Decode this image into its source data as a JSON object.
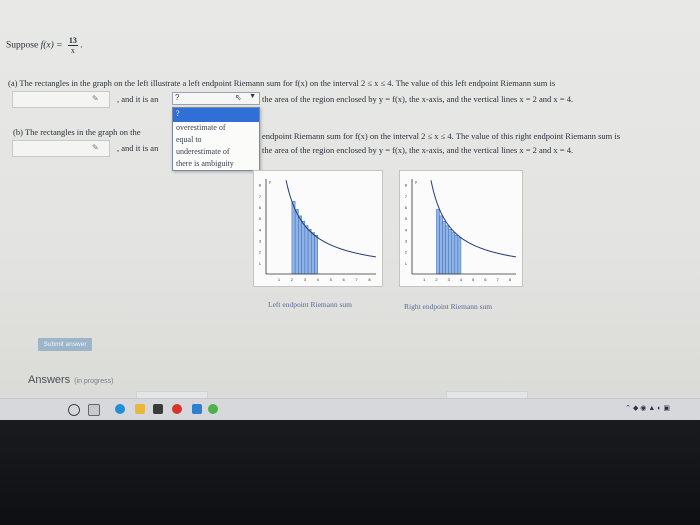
{
  "problem": {
    "suppose_label": "Suppose",
    "function_lhs": "f(x) =",
    "numerator": "13",
    "denominator": "x",
    "period": "."
  },
  "part_a": {
    "text_line1": "(a) The rectangles in the graph on the left illustrate a left endpoint Riemann sum for f(x) on the interval 2 ≤ x ≤ 4. The value of this left endpoint Riemann sum is",
    "text_mid": ", and it is an",
    "text_after_select": "the area of the region enclosed by y = f(x), the x-axis, and the vertical lines x = 2 and x = 4.",
    "select_value": "?",
    "pencil": "✎"
  },
  "part_b": {
    "text_prefix": "(b) The rectangles in the graph on the",
    "text_line1_rest": "endpoint Riemann sum for f(x) on the interval 2 ≤ x ≤ 4. The value of this right endpoint Riemann sum is",
    "text_mid": ", and it is an",
    "text_after": "the area of the region enclosed by y = f(x), the x-axis, and the vertical lines x = 2 and x = 4.",
    "pencil": "✎"
  },
  "dropdown": {
    "options": [
      "?",
      "overestimate of",
      "equal to",
      "underestimate of",
      "there is ambiguity"
    ],
    "selected_index": 0
  },
  "charts": [
    {
      "caption": "Left endpoint Riemann sum",
      "y_ticks": [
        "8",
        "7",
        "6",
        "5",
        "4",
        "3",
        "2",
        "1"
      ],
      "x_ticks": [
        "1",
        "2",
        "3",
        "4",
        "5",
        "6",
        "7",
        "8"
      ],
      "y_axis_label": "y",
      "rule": "left"
    },
    {
      "caption": "Right endpoint Riemann sum",
      "y_ticks": [
        "8",
        "7",
        "6",
        "5",
        "4",
        "3",
        "2",
        "1"
      ],
      "x_ticks": [
        "1",
        "2",
        "3",
        "4",
        "5",
        "6",
        "7",
        "8"
      ],
      "y_axis_label": "y",
      "rule": "right"
    }
  ],
  "submit": {
    "label": "Submit answer"
  },
  "answers": {
    "label": "Answers",
    "status": "(in progress)"
  },
  "colors": {
    "bar_fill": "#8fb3e6",
    "bar_stroke": "#3f6fb7",
    "curve": "#243a78",
    "select_highlight": "#2f6fd6"
  }
}
